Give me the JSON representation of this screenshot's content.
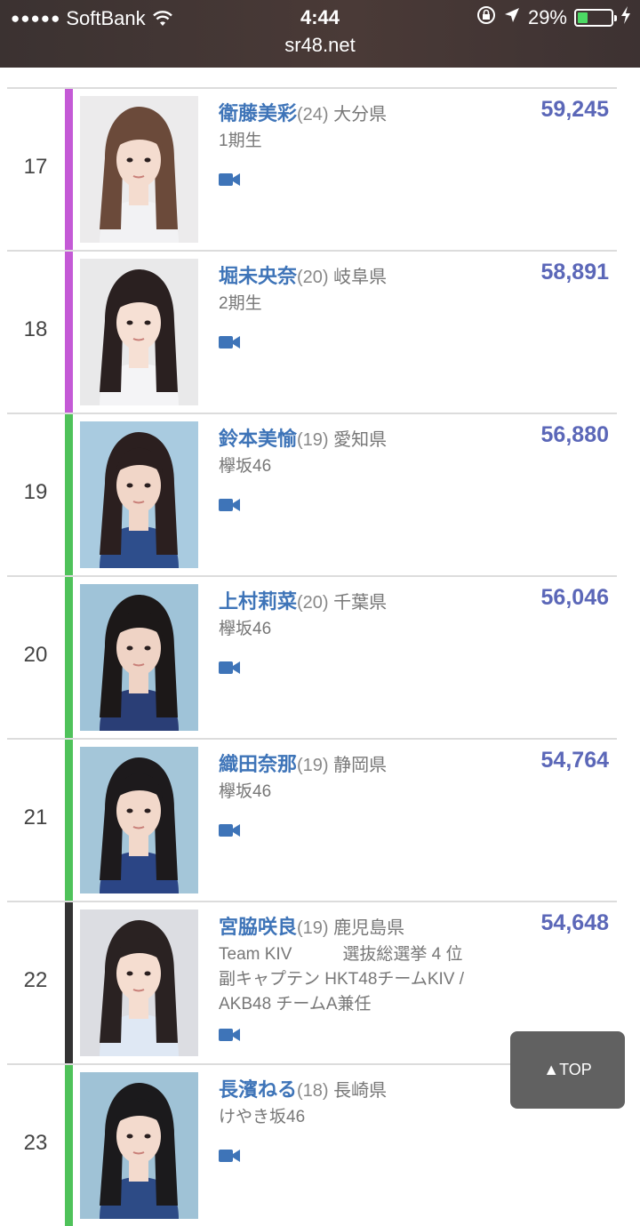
{
  "status_bar": {
    "signal": "●●●●●",
    "carrier": "SoftBank",
    "time": "4:44",
    "battery_percent": "29%",
    "battery_level": 0.29,
    "url": "sr48.net"
  },
  "entries": [
    {
      "rank": "17",
      "name": "衛藤美彩",
      "age": "(24)",
      "prefecture": "大分県",
      "info": [
        "1期生"
      ],
      "votes": "59,245",
      "group_color": "#c45ad6"
    },
    {
      "rank": "18",
      "name": "堀未央奈",
      "age": "(20)",
      "prefecture": "岐阜県",
      "info": [
        "2期生"
      ],
      "votes": "58,891",
      "group_color": "#c45ad6"
    },
    {
      "rank": "19",
      "name": "鈴本美愉",
      "age": "(19)",
      "prefecture": "愛知県",
      "info": [
        "欅坂46"
      ],
      "votes": "56,880",
      "group_color": "#4fc25a"
    },
    {
      "rank": "20",
      "name": "上村莉菜",
      "age": "(20)",
      "prefecture": "千葉県",
      "info": [
        "欅坂46"
      ],
      "votes": "56,046",
      "group_color": "#4fc25a"
    },
    {
      "rank": "21",
      "name": "織田奈那",
      "age": "(19)",
      "prefecture": "静岡県",
      "info": [
        "欅坂46"
      ],
      "votes": "54,764",
      "group_color": "#4fc25a"
    },
    {
      "rank": "22",
      "name": "宮脇咲良",
      "age": "(19)",
      "prefecture": "鹿児島県",
      "info": [
        "Team KIV　　　選抜総選挙 4 位",
        "副キャプテン HKT48チームKIV /",
        "AKB48 チームA兼任"
      ],
      "votes": "54,648",
      "group_color": "#333333"
    },
    {
      "rank": "23",
      "name": "長濱ねる",
      "age": "(18)",
      "prefecture": "長崎県",
      "info": [
        "けやき坂46"
      ],
      "votes": "",
      "group_color": "#4fc25a"
    }
  ],
  "top_button": "▲TOP"
}
